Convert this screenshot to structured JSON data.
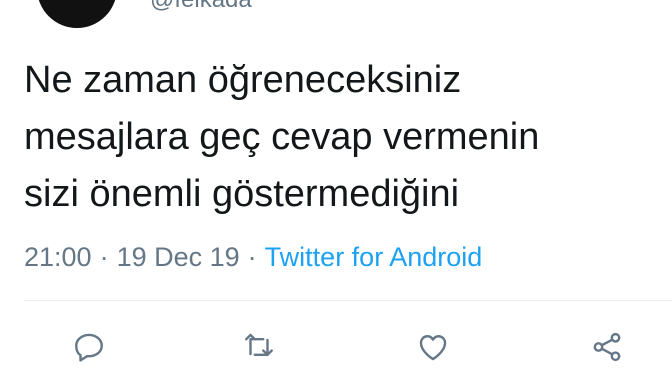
{
  "author": {
    "handle": "@feikada"
  },
  "tweet": {
    "lines": [
      "Ne zaman öğreneceksiniz",
      "mesajlara geç cevap vermenin",
      "sizi önemli göstermediğini"
    ]
  },
  "meta": {
    "time": "21:00",
    "separator": "·",
    "date": "19 Dec 19",
    "source": "Twitter for Android"
  },
  "actions": {
    "reply_icon": "speech-bubble",
    "retweet_icon": "retweet-arrows",
    "like_icon": "heart",
    "share_icon": "share-nodes"
  },
  "colors": {
    "text": "#14171a",
    "secondary": "#657786",
    "link": "#1da1f2",
    "divider": "#e6ecf0"
  }
}
